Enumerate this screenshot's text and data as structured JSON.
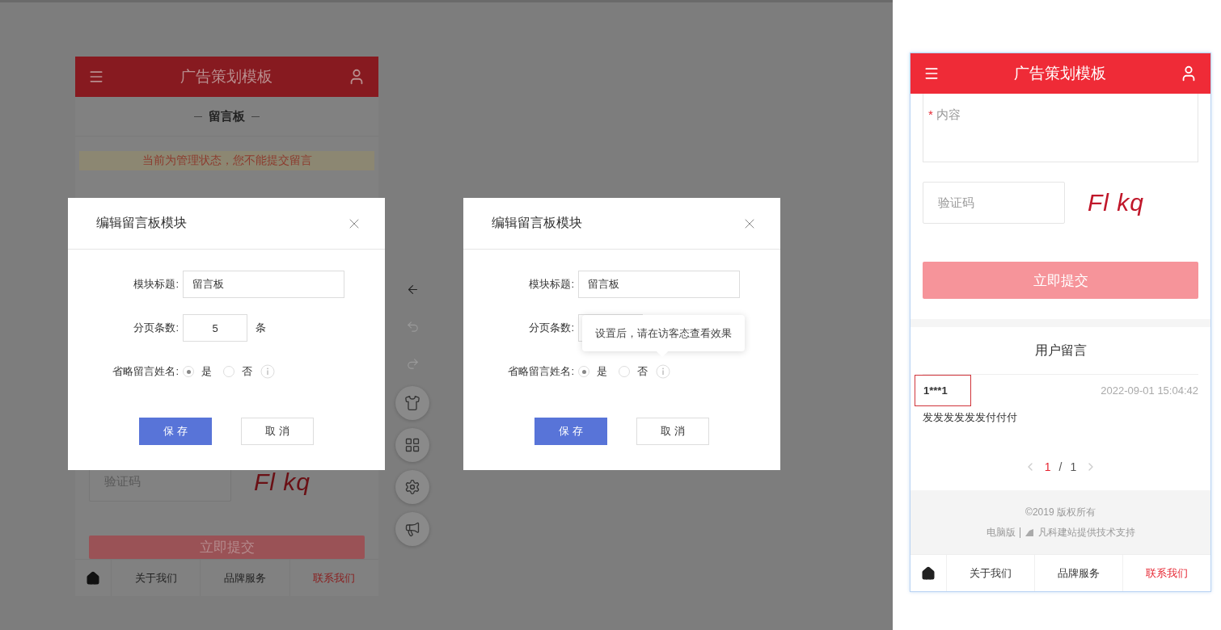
{
  "left_preview": {
    "header_title": "广告策划模板",
    "section_title": "留言板",
    "notice": "当前为管理状态，您不能提交留言",
    "captcha_placeholder": "验证码",
    "captcha": "Fl kq",
    "submit": "立即提交",
    "nav": [
      {
        "kind": "home",
        "selected": false
      },
      {
        "kind": "link",
        "label": "关于我们",
        "selected": false
      },
      {
        "kind": "link",
        "label": "品牌服务",
        "selected": false
      },
      {
        "kind": "link",
        "label": "联系我们",
        "selected": true
      }
    ]
  },
  "dialogs": [
    {
      "title": "编辑留言板模块",
      "fields": [
        {
          "kind": "text",
          "label": "模块标题:",
          "value": "留言板"
        },
        {
          "kind": "number",
          "label": "分页条数:",
          "value": "5",
          "unit": "条"
        },
        {
          "kind": "radio",
          "label": "省略留言姓名:",
          "options": [
            {
              "label": "是",
              "selected": true
            },
            {
              "label": "否",
              "selected": false
            }
          ]
        }
      ],
      "buttons": [
        {
          "kind": "primary",
          "label": "保 存"
        },
        {
          "kind": "secondary",
          "label": "取 消"
        }
      ]
    },
    {
      "title": "编辑留言板模块",
      "fields": [
        {
          "kind": "text",
          "label": "模块标题:",
          "value": "留言板"
        },
        {
          "kind": "number",
          "label": "分页条数:"
        },
        {
          "kind": "radio",
          "label": "省略留言姓名:",
          "options": [
            {
              "label": "是",
              "selected": true
            },
            {
              "label": "否",
              "selected": false
            }
          ]
        }
      ],
      "buttons": [
        {
          "kind": "primary",
          "label": "保 存"
        },
        {
          "kind": "secondary",
          "label": "取 消"
        }
      ],
      "tooltip": "设置后，请在访客态查看效果"
    }
  ],
  "toolbar": [
    {
      "kind": "back",
      "disabled": false
    },
    {
      "kind": "undo",
      "disabled": true
    },
    {
      "kind": "redo",
      "disabled": true
    },
    {
      "kind": "theme"
    },
    {
      "kind": "modules"
    },
    {
      "kind": "settings"
    },
    {
      "kind": "sound"
    }
  ],
  "right_preview": {
    "header_title": "广告策划模板",
    "required_mark": "*",
    "content_placeholder": "内容",
    "captcha_placeholder": "验证码",
    "captcha": "Fl kq",
    "submit": "立即提交",
    "comments_title": "用户留言",
    "comments": [
      {
        "name": "1***1",
        "time": "2022-09-01 15:04:42",
        "text": "发发发发发发付付付",
        "highlighted": true
      }
    ],
    "pagination": {
      "current": "1",
      "separator": "/",
      "total": "1"
    },
    "footer": {
      "copyright": "©2019 版权所有",
      "desktop_link": "电脑版",
      "support": "凡科建站提供技术支持"
    },
    "nav": [
      {
        "kind": "home",
        "selected": false
      },
      {
        "kind": "link",
        "label": "关于我们",
        "selected": false
      },
      {
        "kind": "link",
        "label": "品牌服务",
        "selected": false
      },
      {
        "kind": "link",
        "label": "联系我们",
        "selected": true
      }
    ]
  }
}
